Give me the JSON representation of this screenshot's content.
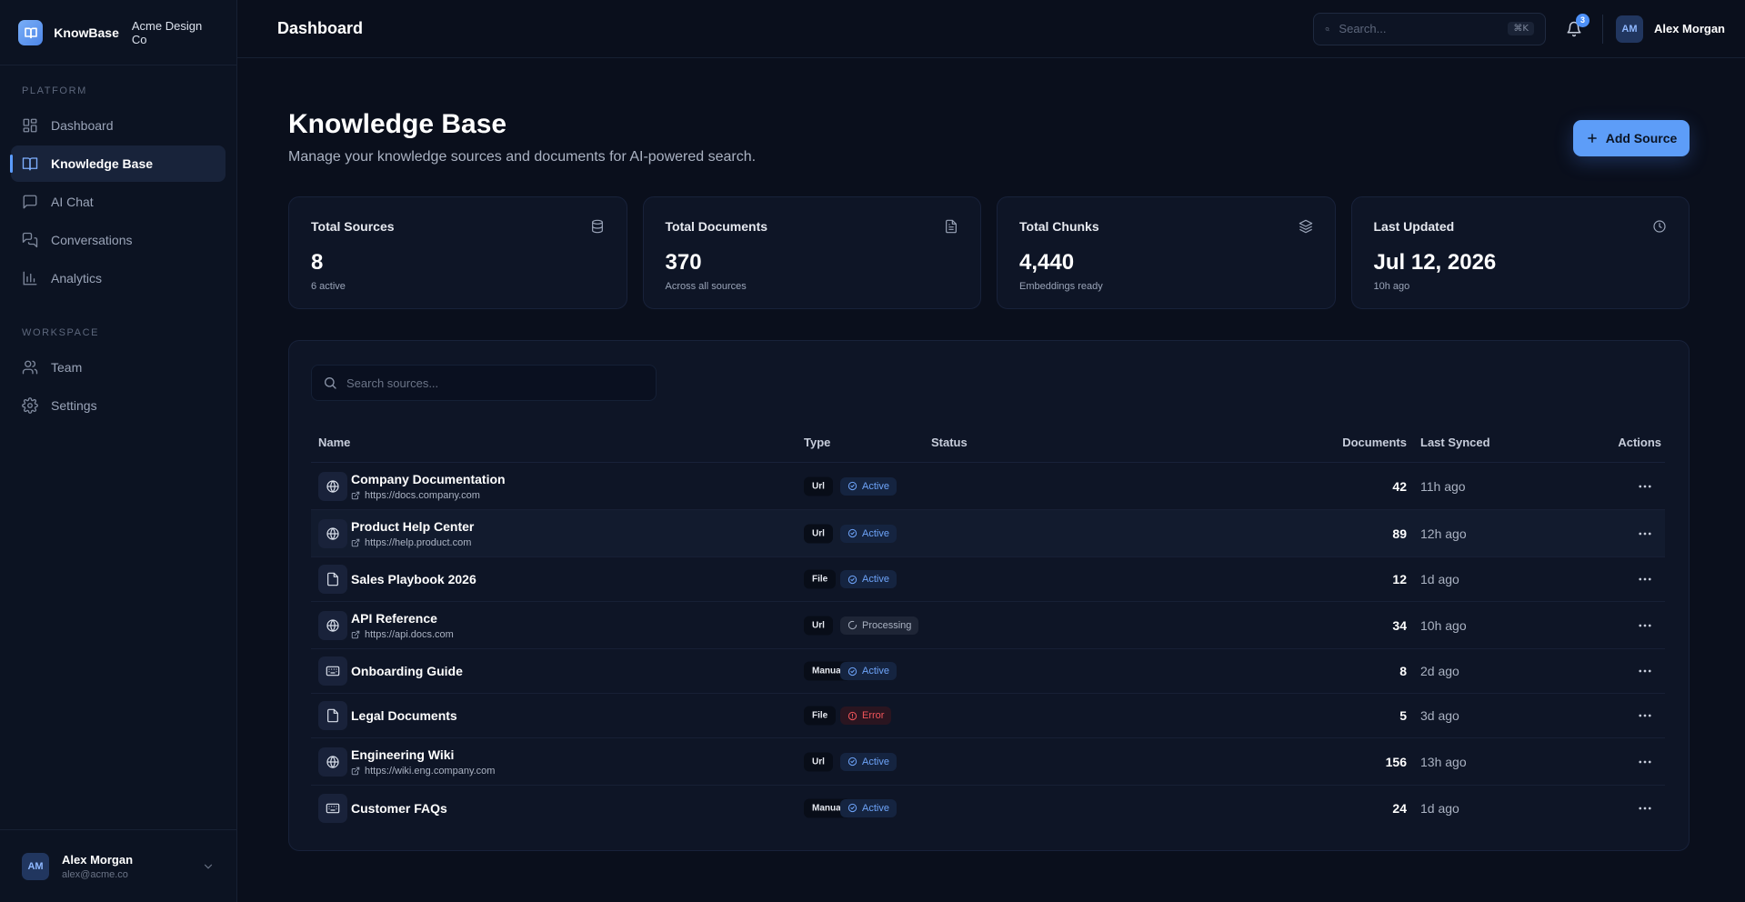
{
  "brand": {
    "name": "KnowBase",
    "org": "Acme Design Co"
  },
  "sidebar": {
    "sections": [
      {
        "title": "PLATFORM",
        "items": [
          {
            "label": "Dashboard",
            "icon": "grid-icon"
          },
          {
            "label": "Knowledge Base",
            "icon": "book-icon",
            "active": true
          },
          {
            "label": "AI Chat",
            "icon": "chat-icon"
          },
          {
            "label": "Conversations",
            "icon": "conversations-icon"
          },
          {
            "label": "Analytics",
            "icon": "bar-chart-icon"
          }
        ]
      },
      {
        "title": "WORKSPACE",
        "items": [
          {
            "label": "Team",
            "icon": "users-icon"
          },
          {
            "label": "Settings",
            "icon": "gear-icon"
          }
        ]
      }
    ],
    "user": {
      "initials": "AM",
      "name": "Alex Morgan",
      "email": "alex@acme.co"
    }
  },
  "header": {
    "title": "Dashboard",
    "search_placeholder": "Search...",
    "shortcut": "⌘K",
    "notifications": "3",
    "user": {
      "initials": "AM",
      "name": "Alex Morgan"
    }
  },
  "page": {
    "title": "Knowledge Base",
    "subtitle": "Manage your knowledge sources and documents for AI-powered search.",
    "add_button": "Add Source"
  },
  "stats": [
    {
      "label": "Total Sources",
      "value": "8",
      "sub": "6 active",
      "icon": "database-icon"
    },
    {
      "label": "Total Documents",
      "value": "370",
      "sub": "Across all sources",
      "icon": "document-icon"
    },
    {
      "label": "Total Chunks",
      "value": "4,440",
      "sub": "Embeddings ready",
      "icon": "layers-icon"
    },
    {
      "label": "Last Updated",
      "value": "Jul 12, 2026",
      "sub": "10h ago",
      "icon": "clock-icon"
    }
  ],
  "table": {
    "search_placeholder": "Search sources...",
    "columns": {
      "name": "Name",
      "type": "Type",
      "status": "Status",
      "documents": "Documents",
      "last_synced": "Last Synced",
      "actions": "Actions"
    },
    "rows": [
      {
        "name": "Company Documentation",
        "url": "https://docs.company.com",
        "kind": "globe",
        "type": "Url",
        "status": "Active",
        "documents": "42",
        "last_synced": "11h ago"
      },
      {
        "name": "Product Help Center",
        "url": "https://help.product.com",
        "kind": "globe",
        "type": "Url",
        "status": "Active",
        "documents": "89",
        "last_synced": "12h ago"
      },
      {
        "name": "Sales Playbook 2026",
        "url": "",
        "kind": "file",
        "type": "File",
        "status": "Active",
        "documents": "12",
        "last_synced": "1d ago"
      },
      {
        "name": "API Reference",
        "url": "https://api.docs.com",
        "kind": "globe",
        "type": "Url",
        "status": "Processing",
        "documents": "34",
        "last_synced": "10h ago"
      },
      {
        "name": "Onboarding Guide",
        "url": "",
        "kind": "keyboard",
        "type": "Manual",
        "status": "Active",
        "documents": "8",
        "last_synced": "2d ago"
      },
      {
        "name": "Legal Documents",
        "url": "",
        "kind": "file",
        "type": "File",
        "status": "Error",
        "documents": "5",
        "last_synced": "3d ago"
      },
      {
        "name": "Engineering Wiki",
        "url": "https://wiki.eng.company.com",
        "kind": "globe",
        "type": "Url",
        "status": "Active",
        "documents": "156",
        "last_synced": "13h ago"
      },
      {
        "name": "Customer FAQs",
        "url": "",
        "kind": "keyboard",
        "type": "Manual",
        "status": "Active",
        "documents": "24",
        "last_synced": "1d ago"
      }
    ]
  },
  "colors": {
    "accent": "#5d9df8",
    "active": "#6ea4f9",
    "error": "#f0555a",
    "background": "#0a0f1c",
    "card": "#0e1526"
  }
}
